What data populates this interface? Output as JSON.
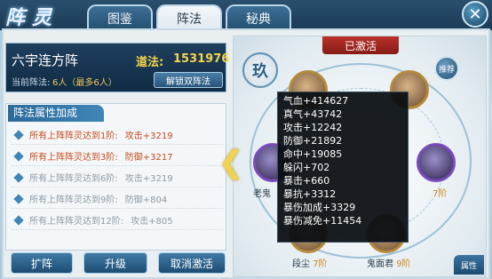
{
  "header": {
    "logo_text": "阵灵",
    "tabs": [
      "图鉴",
      "阵法",
      "秘典"
    ],
    "active_tab": "阵法",
    "close": "✕"
  },
  "formation": {
    "name": "六宇连方阵",
    "power_label": "道法:",
    "power_value": "1531976",
    "current_label": "当前阵法:",
    "current_value": "6人（最多6人）",
    "unlock_button": "解锁双阵法"
  },
  "bonus": {
    "title": "阵法属性加成",
    "rows": [
      {
        "condition": "所有上阵阵灵达到1阶:",
        "effect": "攻击+3219",
        "active": true
      },
      {
        "condition": "所有上阵阵灵达到3阶:",
        "effect": "防御+3217",
        "active": true
      },
      {
        "condition": "所有上阵阵灵达到6阶:",
        "effect": "攻击+3219",
        "active": false
      },
      {
        "condition": "所有上阵阵灵达到9阶:",
        "effect": "防御+804",
        "active": false
      },
      {
        "condition": "所有上阵阵灵达到12阶:",
        "effect": "攻击+805",
        "active": false
      }
    ]
  },
  "buttons": {
    "expand": "扩阵",
    "upgrade": "升级",
    "deactivate": "取消激活",
    "info": "!"
  },
  "right": {
    "activated": "已激活",
    "seal": "玖",
    "recommend": "推荐",
    "corner": "属性",
    "avatars": [
      {
        "name": "老鬼",
        "level": ""
      },
      {
        "name": "",
        "level": "7阶"
      },
      {
        "name": "段尘",
        "level": "7阶"
      },
      {
        "name": "鬼面君",
        "level": "9阶"
      }
    ]
  },
  "tooltip": {
    "lines": [
      "气血+414627",
      "真气+43742",
      "攻击+12242",
      "防御+21892",
      "命中+19085",
      "躲闪+702",
      "暴击+660",
      "暴抗+3312",
      "暴伤加成+3329",
      "暴伤减免+11454"
    ]
  },
  "colors": {
    "accent_gold": "#f6d44b",
    "inactive_text": "#8d9aa4",
    "active_text": "#c54a1c",
    "banner_red": "#b8322a"
  }
}
